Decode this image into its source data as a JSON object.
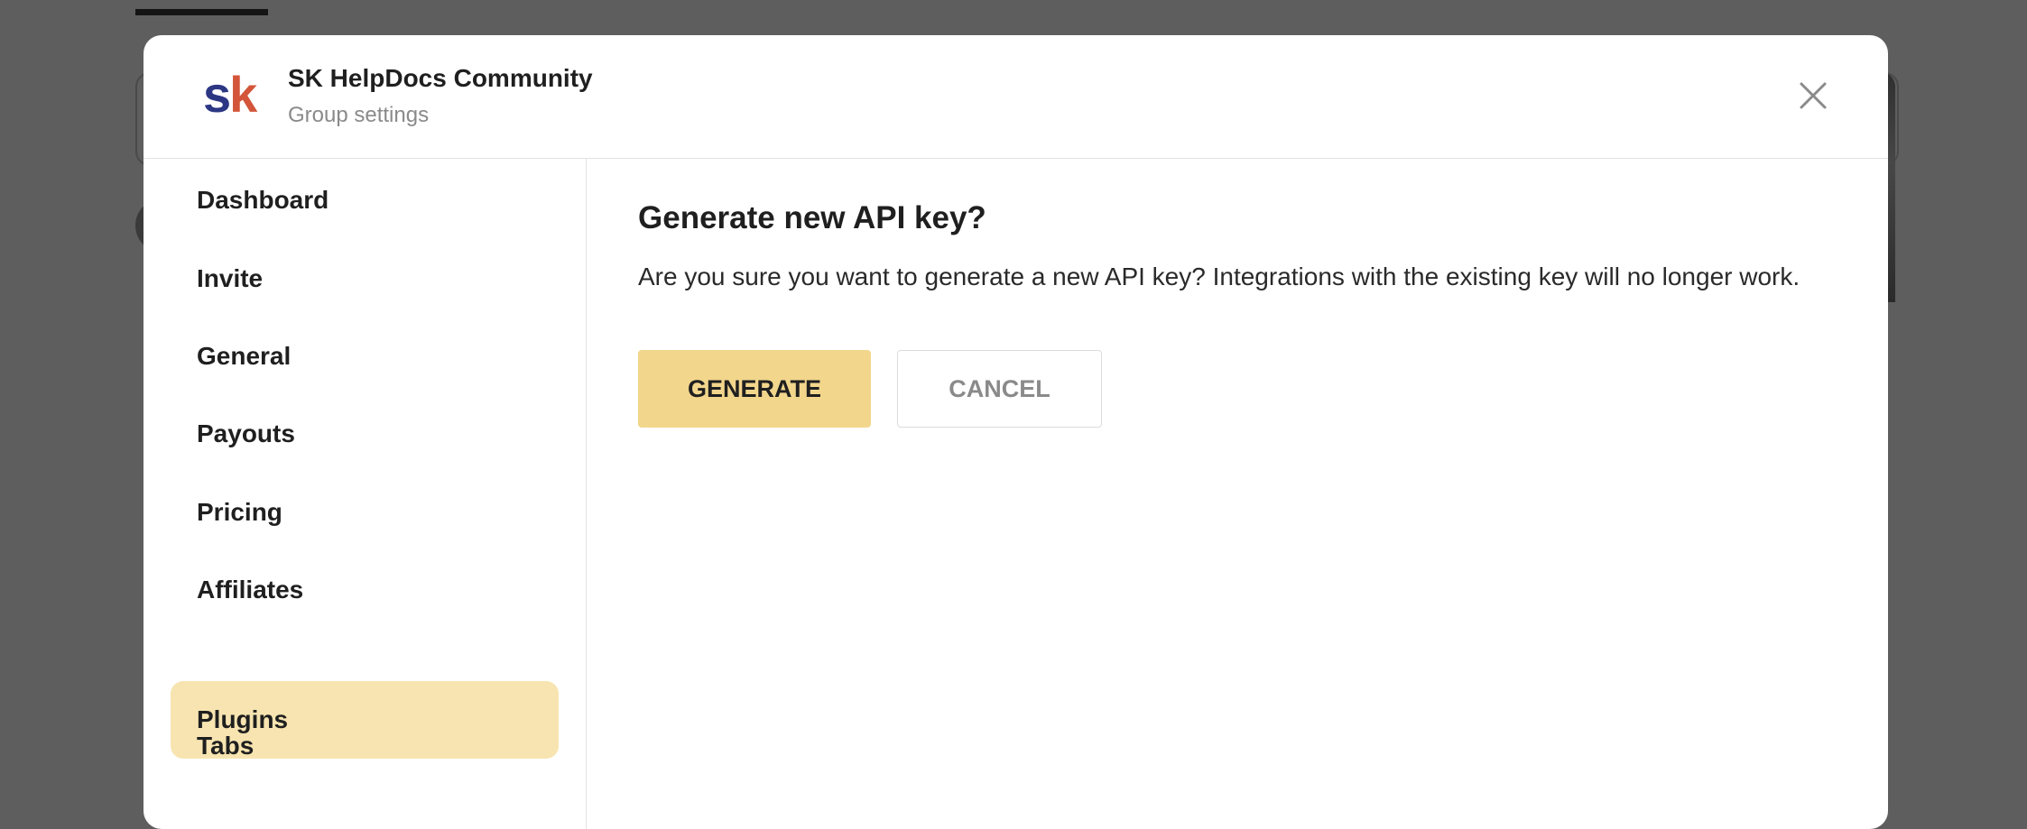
{
  "app": {
    "community_name": "SK HelpDocs Community",
    "subtitle": "Group settings",
    "logo": {
      "letter_1": "s",
      "letter_2": "k",
      "color_1": "#2c3784",
      "color_2": "#d3553a"
    }
  },
  "header": {
    "close_icon": "close-icon"
  },
  "sidebar": {
    "items": [
      {
        "label": "Dashboard",
        "active": false
      },
      {
        "label": "Invite",
        "active": false
      },
      {
        "label": "General",
        "active": false
      },
      {
        "label": "Payouts",
        "active": false
      },
      {
        "label": "Pricing",
        "active": false
      },
      {
        "label": "Affiliates",
        "active": false
      },
      {
        "label": "Plugins",
        "active": true
      },
      {
        "label": "Tabs",
        "active": false
      }
    ]
  },
  "dialog": {
    "title": "Generate new API key?",
    "message": "Are you sure you want to generate a new API key? Integrations with the existing key will no longer work.",
    "generate_label": "GENERATE",
    "cancel_label": "CANCEL"
  },
  "colors": {
    "accent": "#f2d68c",
    "active_nav": "#f7e4b0",
    "overlay": "#5e5e5e"
  }
}
